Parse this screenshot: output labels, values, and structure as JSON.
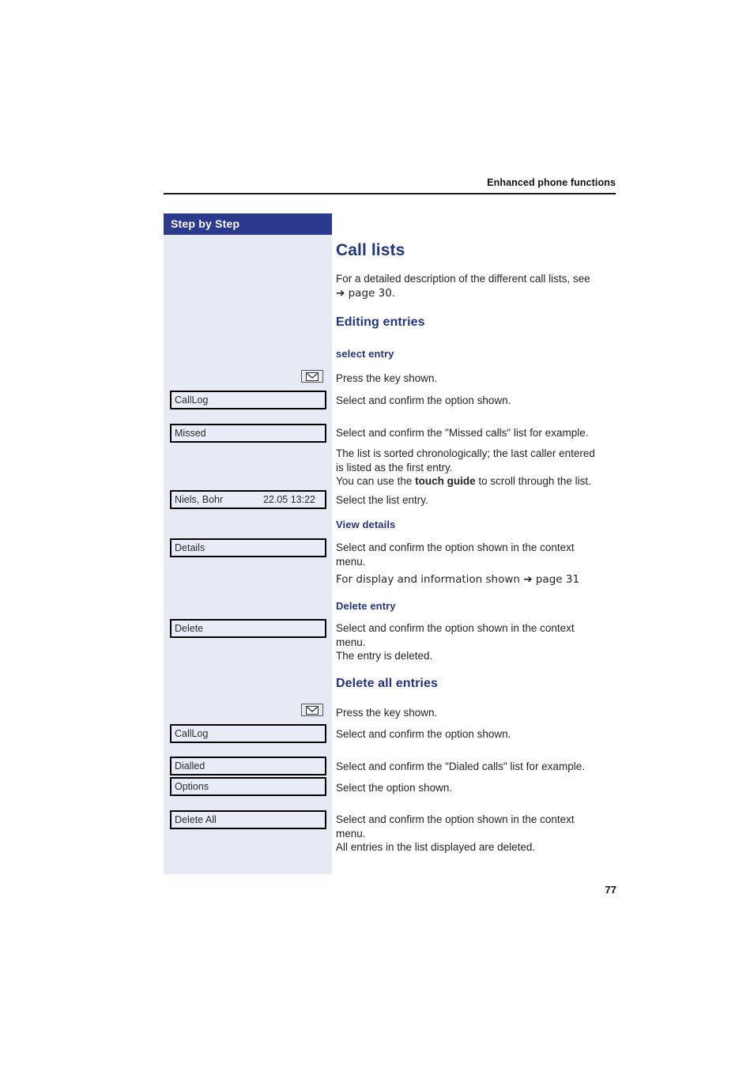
{
  "document": {
    "running_header": "Enhanced phone functions",
    "page_number": "77"
  },
  "sidebar": {
    "title": "Step by Step",
    "items": [
      {
        "name": "key-envelope-1",
        "type": "key",
        "icon": "envelope-icon"
      },
      {
        "name": "calllog-box-1",
        "type": "display",
        "label": "CallLog"
      },
      {
        "name": "missed-box",
        "type": "display",
        "label": "Missed"
      },
      {
        "name": "list-entry-box",
        "type": "display",
        "label": "Niels, Bohr",
        "value": "22.05 13:22"
      },
      {
        "name": "details-box",
        "type": "display",
        "label": "Details"
      },
      {
        "name": "delete-box",
        "type": "display",
        "label": "Delete"
      },
      {
        "name": "key-envelope-2",
        "type": "key",
        "icon": "envelope-icon"
      },
      {
        "name": "calllog-box-2",
        "type": "display",
        "label": "CallLog"
      },
      {
        "name": "dialled-box",
        "type": "display",
        "label": "Dialled"
      },
      {
        "name": "options-box",
        "type": "display",
        "label": "Options"
      },
      {
        "name": "delete-all-box",
        "type": "display",
        "label": "Delete All"
      }
    ]
  },
  "main": {
    "title": "Call lists",
    "intro": "For a detailed description of the different call lists, see",
    "intro_ref": "➔ page 30.",
    "section_editing": {
      "heading": "Editing entries",
      "sub_select": "select entry",
      "press_key": "Press the key shown.",
      "select_confirm_option": "Select and confirm the option shown.",
      "select_confirm_missed": "Select and confirm the \"Missed calls\" list for example.",
      "sorted_line1": "The list is sorted chronologically; the last caller entered",
      "sorted_line2": "is listed as the first entry.",
      "touch_prefix": "You can use the ",
      "touch_bold": "touch guide",
      "touch_suffix": " to scroll through the list.",
      "select_list_entry": "Select the list entry."
    },
    "section_view_details": {
      "heading": "View details",
      "line1": "Select and confirm the option shown in the context",
      "line2": "menu.",
      "line3": "For display and information shown ➔ page 31"
    },
    "section_delete_entry": {
      "heading": "Delete entry",
      "line1": "Select and confirm the option shown in the context",
      "line2": "menu.",
      "line3": "The entry is deleted."
    },
    "section_delete_all": {
      "heading": "Delete all entries",
      "press_key": "Press the key shown.",
      "select_confirm_option": "Select and confirm the option shown.",
      "select_confirm_dialed": "Select and confirm the \"Dialed calls\" list for example.",
      "select_option_shown": "Select the option shown.",
      "line1": "Select and confirm the option shown in the context",
      "line2": "menu.",
      "line3": "All entries in the list displayed are deleted."
    }
  },
  "colors": {
    "accent_blue": "#22357f",
    "header_bar": "#2b3a8c",
    "panel_bg": "#e6eaf5",
    "box_bg": "#e8ecf6"
  }
}
